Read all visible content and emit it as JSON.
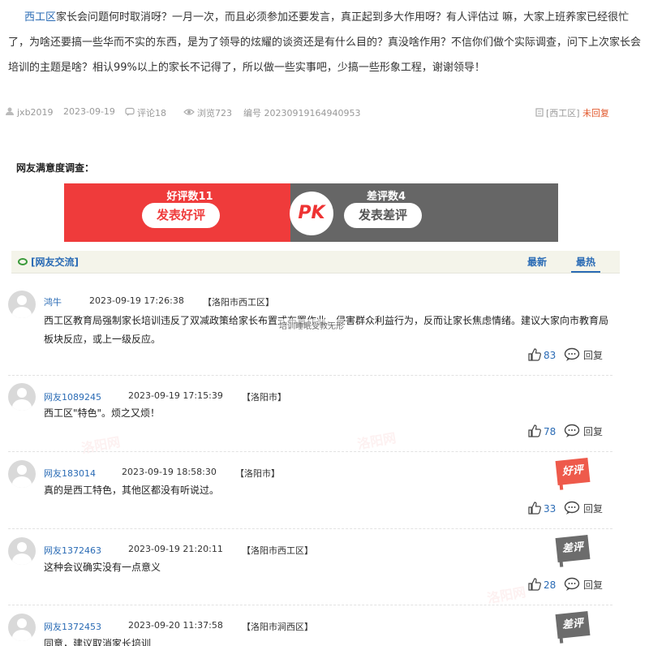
{
  "post": {
    "location": "西工区",
    "text": "家长会问题何时取消呀？一月一次，而且必须参加还要发言，真正起到多大作用呀？有人评估过 嘛，大家上班养家已经很忙了，为啥还要搞一些华而不实的东西，是为了领导的炫耀的谈资还是有什么目的？真没啥作用？不信你们做个实际调查，问下上次家长会培训的主题是啥？相认99%以上的家长不记得了，所以做一些实事吧，少搞一些形象工程，谢谢领导！"
  },
  "meta": {
    "author": "jxb2019",
    "date": "2023-09-19",
    "comments": "评论18",
    "views": "浏览723",
    "serial": "编号 20230919164940953",
    "district": "[西工区]",
    "status": "未回复"
  },
  "satisfaction": {
    "title": "网友满意度调查：",
    "good_count": "好评数11",
    "good_button": "发表好评",
    "pk": "PK",
    "bad_count": "差评数4",
    "bad_button": "发表差评"
  },
  "discussion": {
    "title": "[网友交流]",
    "tab_new": "最新",
    "tab_hot": "最热"
  },
  "comments": [
    {
      "user": "鸿牛",
      "time": "2023-09-19 17:26:38",
      "location": "【洛阳市西工区】",
      "text": "西工区教育局强制家长培训违反了双减政策给家长布置式布置作业，侵害群众利益行为，反而让家长焦虑情绪。建议大家向市教育局板块反应，或上一级反应。",
      "likes": "83",
      "reply": "回复",
      "badge": ""
    },
    {
      "user": "网友1089245",
      "time": "2023-09-19 17:15:39",
      "location": "【洛阳市】",
      "text": "西工区\"特色\"。烦之又烦！",
      "likes": "78",
      "reply": "回复",
      "badge": ""
    },
    {
      "user": "网友183014",
      "time": "2023-09-19 18:58:30",
      "location": "【洛阳市】",
      "text": "真的是西工特色，其他区都没有听说过。",
      "likes": "33",
      "reply": "回复",
      "badge": "好评"
    },
    {
      "user": "网友1372463",
      "time": "2023-09-19 21:20:11",
      "location": "【洛阳市西工区】",
      "text": "这种会议确实没有一点意义",
      "likes": "28",
      "reply": "回复",
      "badge": "差评"
    },
    {
      "user": "网友1372453",
      "time": "2023-09-20 11:37:58",
      "location": "【洛阳市涧西区】",
      "text": "同意，建议取消家长培训",
      "likes": "",
      "reply": "",
      "badge": "差评"
    }
  ],
  "overlay_text": "培训睡眠受教无形",
  "watermark": "洛阳网"
}
